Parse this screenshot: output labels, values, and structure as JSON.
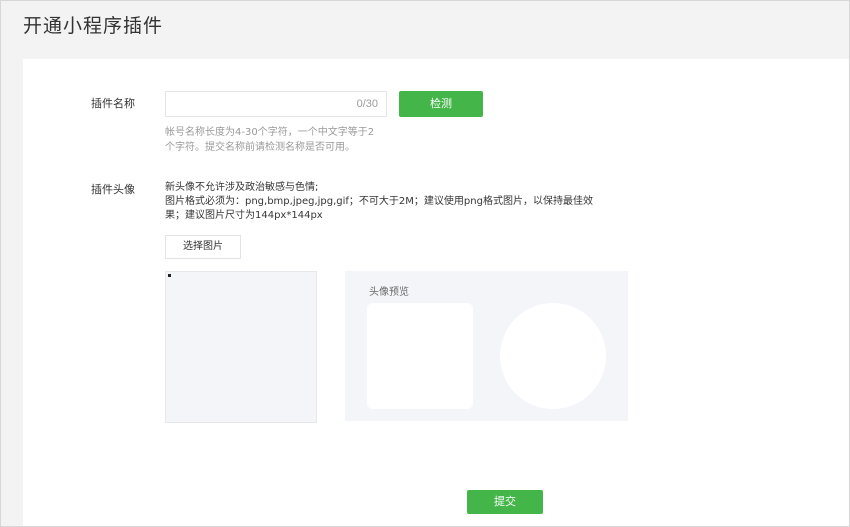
{
  "page": {
    "title": "开通小程序插件"
  },
  "form": {
    "name_label": "插件名称",
    "name_input": {
      "value": "",
      "placeholder": "",
      "counter": "0/30"
    },
    "check_button": "检测",
    "name_hint_lines": [
      "帐号名称长度为4-30个字符，一个中文字等于2",
      "个字符。提交名称前请检测名称是否可用。"
    ],
    "avatar_label": "插件头像",
    "avatar_rules": [
      "新头像不允许涉及政治敏感与色情;",
      "图片格式必须为：png,bmp,jpeg,jpg,gif；不可大于2M；建议使用png格式图片，以保持最佳效",
      "果；建议图片尺寸为144px*144px"
    ],
    "select_image_button": "选择图片",
    "preview_label": "头像预览",
    "submit_button": "提交"
  },
  "colors": {
    "accent_green": "#44b549",
    "page_background": "#f3f3f3",
    "card_background": "#ffffff",
    "preview_background": "#f4f5f9"
  }
}
